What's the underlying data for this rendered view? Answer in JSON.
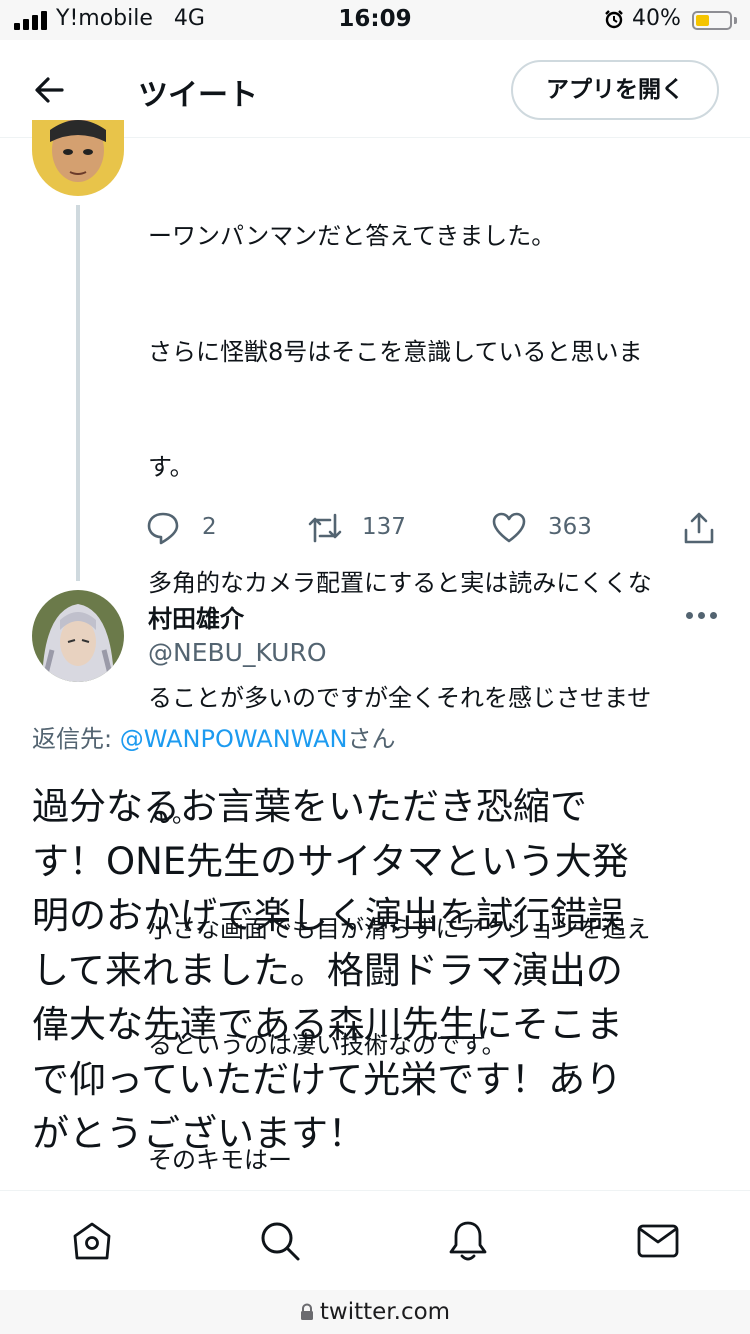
{
  "status_bar": {
    "carrier": "Y!mobile",
    "network": "4G",
    "time": "16:09",
    "battery": "40%",
    "battery_level": 0.4,
    "battery_color": "#f5c400"
  },
  "header": {
    "title": "ツイート",
    "back_icon": "arrow-left-icon",
    "open_app_label": "アプリを開く"
  },
  "previous_tweet": {
    "text_lines": [
      "ーワンパンマンだと答えてきました。",
      "さらに怪獣8号はそこを意識していると思いま",
      "す。",
      "多角的なカメラ配置にすると実は読みにくくな",
      "ることが多いのですが全くそれを感じさせませ",
      "ん。",
      "小さな画面でも目が滑らずにアクションを追え",
      "るというのは凄い技術なのです。",
      "そのキモはー"
    ],
    "replies": "2",
    "retweets": "137",
    "likes": "363"
  },
  "reply_tweet": {
    "display_name": "村田雄介",
    "handle": "@NEBU_KURO",
    "reply_to_label": "返信先: ",
    "reply_to_mention": "@WANPOWANWAN",
    "reply_to_suffix": "さん",
    "text_lines": [
      "過分なるお言葉をいただき恐縮で",
      "す！ONE先生のサイタマという大発",
      "明のおかげで楽しく演出を試行錯誤",
      "して来れました。格闘ドラマ演出の",
      "偉大な先達である森川先生にそこま",
      "で仰っていただけて光栄です！あり",
      "がとうございます！"
    ]
  },
  "bottom_nav": {
    "items": [
      "home-icon",
      "search-icon",
      "notifications-icon",
      "messages-icon"
    ]
  },
  "url_bar": {
    "url": "twitter.com"
  },
  "colors": {
    "accent": "#1d9bf0",
    "secondary_text": "#536471",
    "primary_text": "#0f1419"
  }
}
